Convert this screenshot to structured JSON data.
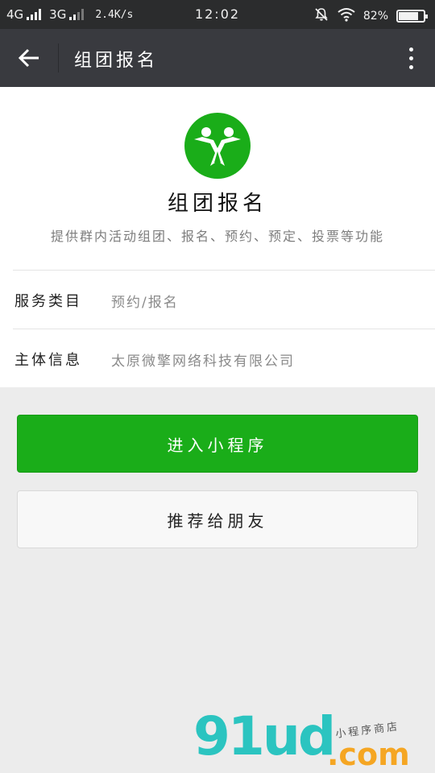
{
  "status_bar": {
    "network1": "4G",
    "network2": "3G",
    "speed": "2.4K/s",
    "time": "12:02",
    "battery_text": "82%",
    "battery_level": 0.82,
    "icons": [
      "signal-icon",
      "mute-icon",
      "wifi-icon",
      "battery-icon"
    ]
  },
  "nav": {
    "title": "组团报名",
    "back_icon": "arrow-left-icon",
    "more_icon": "more-vertical-icon"
  },
  "app": {
    "name": "组团报名",
    "description": "提供群内活动组团、报名、预约、预定、投票等功能",
    "logo_icon": "people-logo-icon",
    "brand_color": "#1aad19"
  },
  "info": [
    {
      "label": "服务类目",
      "value": "预约/报名"
    },
    {
      "label": "主体信息",
      "value": "太原微擎网络科技有限公司"
    }
  ],
  "actions": {
    "primary": "进入小程序",
    "secondary": "推荐给朋友"
  },
  "watermark": {
    "brand": "91ud",
    "domain": ".com",
    "tagline": "小程序商店"
  }
}
